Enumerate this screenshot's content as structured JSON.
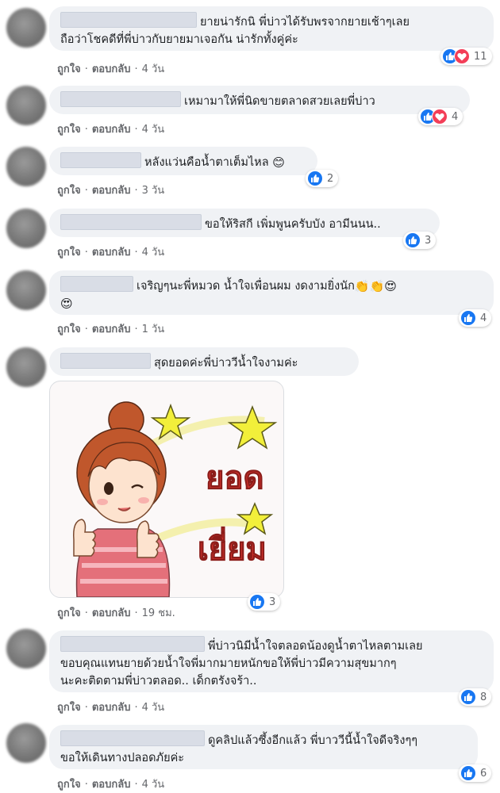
{
  "comments": [
    {
      "line1": "ยายน่ารักนิ พี่บ่าวได้รับพรจากยายเช้าๆเลย",
      "line2": "ถือว่าโชคดีที่พี่บ่าวกับยายมาเจอกัน น่ารักทั้งคู่ค่ะ",
      "like": "ถูกใจ",
      "reply": "ตอบกลับ",
      "time": "4 วัน",
      "reactions": "11",
      "reaction_types": [
        "like-icon",
        "love-icon"
      ]
    },
    {
      "line1": "เหมามาให้พี่นิดขายตลาดสวยเลยพี่บ่าว",
      "like": "ถูกใจ",
      "reply": "ตอบกลับ",
      "time": "4 วัน",
      "reactions": "4",
      "reaction_types": [
        "like-icon",
        "love-icon"
      ]
    },
    {
      "line1": "หลังแว่นคือน้ำตาเต็มไหล",
      "emoji": "😊",
      "like": "ถูกใจ",
      "reply": "ตอบกลับ",
      "time": "3 วัน",
      "reactions": "2",
      "reaction_types": [
        "like-icon"
      ]
    },
    {
      "line1": "ขอให้ริสกี เพิ่มพูนครับบัง อามีนนน..",
      "like": "ถูกใจ",
      "reply": "ตอบกลับ",
      "time": "4 วัน",
      "reactions": "3",
      "reaction_types": [
        "like-icon"
      ]
    },
    {
      "line1": "เจริญๆนะพี่หมวด น้ำใจเพื่อนผม งดงามยิ่งนัก",
      "emoji1": "👏👏😍",
      "emoji2": "😍",
      "like": "ถูกใจ",
      "reply": "ตอบกลับ",
      "time": "1 วัน",
      "reactions": "4",
      "reaction_types": [
        "like-icon"
      ]
    },
    {
      "line1": "สุดยอดค่ะพี่บ่าววีน้ำใจงามค่ะ",
      "sticker_text1": "ยอด",
      "sticker_text2": "เยี่ยม",
      "like": "ถูกใจ",
      "reply": "ตอบกลับ",
      "time": "19 ชม.",
      "reactions": "3",
      "reaction_types": [
        "like-icon"
      ]
    },
    {
      "line1": "พี่บ่าวนิมีน้ำใจตลอดน้องดูน้ำตาไหลตามเลย",
      "line2": "ขอบคุณแทนยายด้วยน้ำใจพี่มากมายหนักขอให้พี่บ่าวมีความสุขมากๆ",
      "line3": "นะคะติดตามพี่บ่าวตลอด.. เด็กตรังจร้า..",
      "like": "ถูกใจ",
      "reply": "ตอบกลับ",
      "time": "4 วัน",
      "reactions": "8",
      "reaction_types": [
        "like-icon"
      ]
    },
    {
      "line1": "ดูคลิปแล้วซึ้งอีกแล้ว พี่บาววีนี้น้ำใจดีจริงๆๆ",
      "line2": "ขอให้เดินทางปลอดภัยค่ะ",
      "like": "ถูกใจ",
      "reply": "ตอบกลับ",
      "time": "4 วัน",
      "reactions": "6",
      "reaction_types": [
        "like-icon"
      ]
    }
  ],
  "colors": {
    "like": "#1877f2",
    "love": "#f33e58",
    "bubble": "#f0f2f5",
    "meta": "#65676b"
  }
}
